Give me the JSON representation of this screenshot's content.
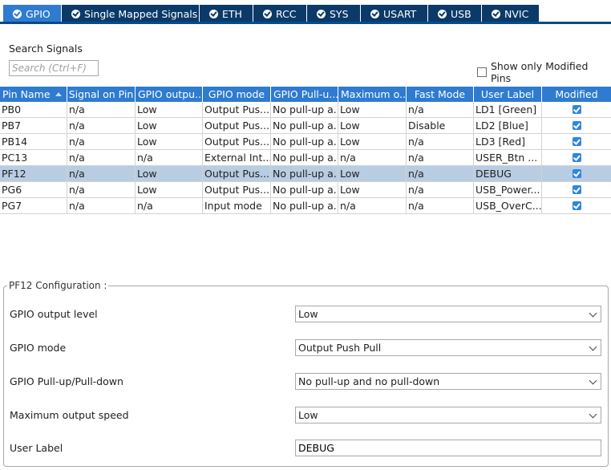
{
  "tabs": [
    {
      "label": "GPIO",
      "active": true
    },
    {
      "label": "Single Mapped Signals"
    },
    {
      "label": "ETH"
    },
    {
      "label": "RCC"
    },
    {
      "label": "SYS"
    },
    {
      "label": "USART"
    },
    {
      "label": "USB"
    },
    {
      "label": "NVIC"
    }
  ],
  "search": {
    "label": "Search Signals",
    "placeholder": "Search (Ctrl+F)",
    "value": ""
  },
  "filter": {
    "show_only_modified_label": "Show only Modified Pins",
    "checked": false
  },
  "table": {
    "columns": [
      "Pin Name",
      "Signal on Pin",
      "GPIO outpu...",
      "GPIO mode",
      "GPIO Pull-u...",
      "Maximum o...",
      "Fast Mode",
      "User Label",
      "Modified"
    ],
    "rows": [
      {
        "pin": "PB0",
        "signal": "n/a",
        "output": "Low",
        "mode": "Output Pus...",
        "pull": "No pull-up a...",
        "speed": "Low",
        "fast": "n/a",
        "label": "LD1 [Green]",
        "modified": true
      },
      {
        "pin": "PB7",
        "signal": "n/a",
        "output": "Low",
        "mode": "Output Pus...",
        "pull": "No pull-up a...",
        "speed": "Low",
        "fast": "Disable",
        "label": "LD2 [Blue]",
        "modified": true
      },
      {
        "pin": "PB14",
        "signal": "n/a",
        "output": "Low",
        "mode": "Output Pus...",
        "pull": "No pull-up a...",
        "speed": "Low",
        "fast": "n/a",
        "label": "LD3 [Red]",
        "modified": true
      },
      {
        "pin": "PC13",
        "signal": "n/a",
        "output": "n/a",
        "mode": "External Int...",
        "pull": "No pull-up a...",
        "speed": "n/a",
        "fast": "n/a",
        "label": "USER_Btn ...",
        "modified": true
      },
      {
        "pin": "PF12",
        "signal": "n/a",
        "output": "Low",
        "mode": "Output Pus...",
        "pull": "No pull-up a...",
        "speed": "Low",
        "fast": "n/a",
        "label": "DEBUG",
        "modified": true,
        "selected": true
      },
      {
        "pin": "PG6",
        "signal": "n/a",
        "output": "Low",
        "mode": "Output Pus...",
        "pull": "No pull-up a...",
        "speed": "Low",
        "fast": "n/a",
        "label": "USB_Power...",
        "modified": true
      },
      {
        "pin": "PG7",
        "signal": "n/a",
        "output": "n/a",
        "mode": "Input mode",
        "pull": "No pull-up a...",
        "speed": "n/a",
        "fast": "n/a",
        "label": "USB_OverC...",
        "modified": true
      }
    ]
  },
  "config": {
    "title": "PF12 Configuration :",
    "output_level": {
      "label": "GPIO output level",
      "value": "Low"
    },
    "mode": {
      "label": "GPIO mode",
      "value": "Output Push Pull"
    },
    "pull": {
      "label": "GPIO Pull-up/Pull-down",
      "value": "No pull-up and no pull-down"
    },
    "speed": {
      "label": "Maximum output speed",
      "value": "Low"
    },
    "user_label": {
      "label": "User Label",
      "value": "DEBUG"
    }
  }
}
